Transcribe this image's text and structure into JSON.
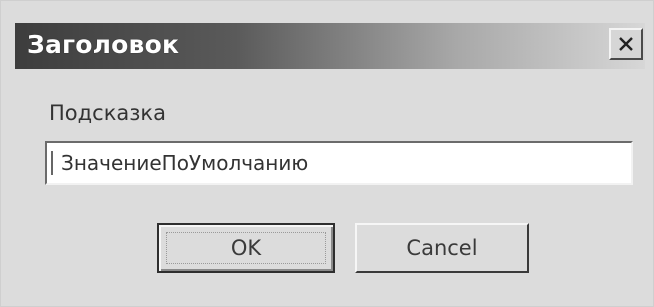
{
  "window": {
    "title": "Заголовок",
    "close_icon": "close-icon"
  },
  "form": {
    "prompt_label": "Подсказка",
    "input_value": "ЗначениеПоУмолчанию"
  },
  "buttons": {
    "ok_label": "OK",
    "cancel_label": "Cancel"
  },
  "colors": {
    "titlebar_dark": "#3d3d3d",
    "titlebar_light": "#d7d7d7",
    "dialog_bg": "#dcdcdc"
  }
}
